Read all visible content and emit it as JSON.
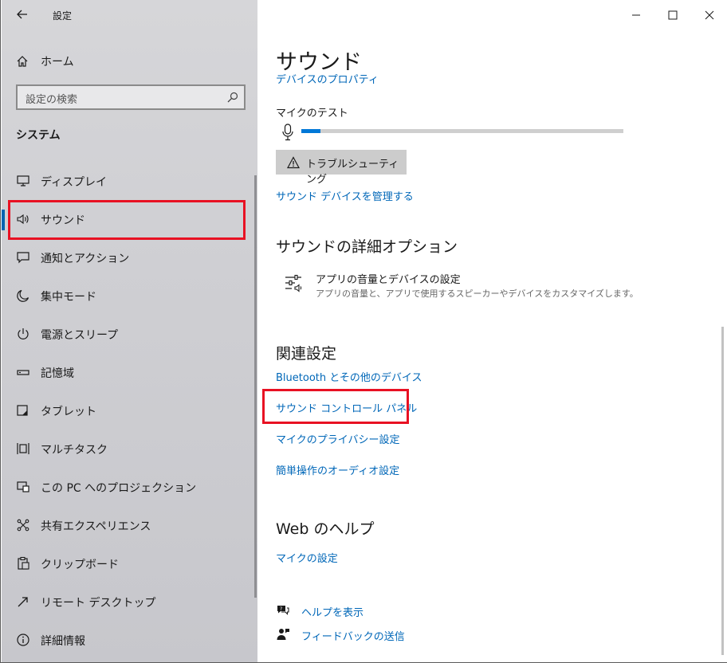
{
  "app": {
    "title": "設定"
  },
  "sidebar": {
    "home_label": "ホーム",
    "search_placeholder": "設定の検索",
    "section_title": "システム",
    "items": [
      {
        "label": "ディスプレイ",
        "icon": "monitor-icon"
      },
      {
        "label": "サウンド",
        "icon": "speaker-icon",
        "selected": true
      },
      {
        "label": "通知とアクション",
        "icon": "notification-icon"
      },
      {
        "label": "集中モード",
        "icon": "moon-icon"
      },
      {
        "label": "電源とスリープ",
        "icon": "power-icon"
      },
      {
        "label": "記憶域",
        "icon": "storage-icon"
      },
      {
        "label": "タブレット",
        "icon": "tablet-icon"
      },
      {
        "label": "マルチタスク",
        "icon": "multitask-icon"
      },
      {
        "label": "この PC へのプロジェクション",
        "icon": "projection-icon"
      },
      {
        "label": "共有エクスペリエンス",
        "icon": "share-icon"
      },
      {
        "label": "クリップボード",
        "icon": "clipboard-icon"
      },
      {
        "label": "リモート デスクトップ",
        "icon": "remote-desktop-icon"
      },
      {
        "label": "詳細情報",
        "icon": "info-icon"
      }
    ]
  },
  "main": {
    "page_title": "サウンド",
    "cut_link": "デバイスのプロパティ",
    "mic_test_label": "マイクのテスト",
    "mic_level": 0.06,
    "troubleshoot_label": "トラブルシューティング",
    "manage_devices_link": "サウンド デバイスを管理する",
    "advanced": {
      "heading": "サウンドの詳細オプション",
      "item_title": "アプリの音量とデバイスの設定",
      "item_desc": "アプリの音量と、アプリで使用するスピーカーやデバイスをカスタマイズします。"
    },
    "related": {
      "heading": "関連設定",
      "links": [
        "Bluetooth とその他のデバイス",
        "サウンド コントロール パネル",
        "マイクのプライバシー設定",
        "簡単操作のオーディオ設定"
      ]
    },
    "web_help": {
      "heading": "Web のヘルプ",
      "link": "マイクの設定"
    },
    "help_label": "ヘルプを表示",
    "feedback_label": "フィードバックの送信"
  },
  "colors": {
    "accent": "#0078d7",
    "link": "#0067b8",
    "highlight_box": "#e81123"
  }
}
